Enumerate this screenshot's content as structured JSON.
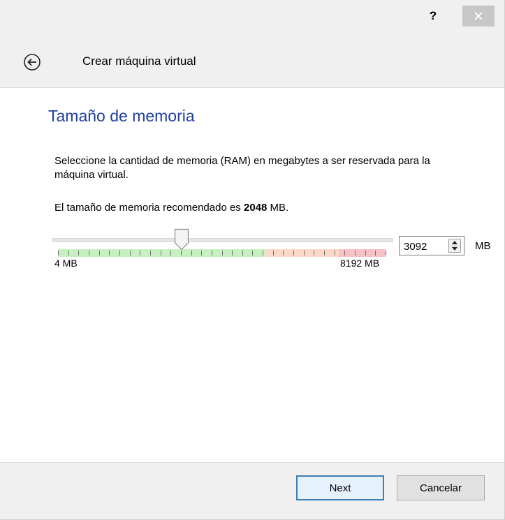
{
  "titlebar": {
    "help_label": "?",
    "close_icon": "close-icon"
  },
  "header": {
    "back_icon": "back-arrow-icon",
    "title": "Crear máquina virtual"
  },
  "page": {
    "title": "Tamaño de memoria",
    "description": "Seleccione la cantidad de memoria (RAM) en megabytes a ser reservada para la máquina virtual.",
    "recommend_prefix": "El tamaño de memoria recomendado es ",
    "recommend_value": "2048",
    "recommend_suffix": " MB."
  },
  "memory": {
    "value": "3092",
    "unit": "MB",
    "min_label": "4 MB",
    "max_label": "8192 MB",
    "min": 4,
    "max": 8192,
    "current": 3092
  },
  "colors": {
    "title_blue": "#1f3f9d",
    "zone_green": "#c7f0c0",
    "zone_orange": "#fbd8c7",
    "zone_red": "#f7c1c8"
  },
  "buttons": {
    "next_label": "Next",
    "cancel_label": "Cancelar"
  }
}
